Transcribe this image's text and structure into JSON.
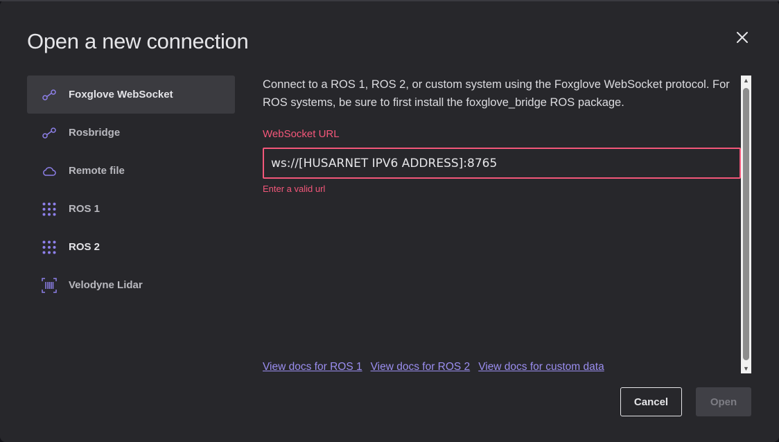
{
  "dialog": {
    "title": "Open a new connection",
    "close_icon": "close-icon"
  },
  "sidebar": {
    "items": [
      {
        "label": "Foxglove WebSocket",
        "icon": "websocket-connection-icon",
        "active": true
      },
      {
        "label": "Rosbridge",
        "icon": "websocket-connection-icon",
        "active": false
      },
      {
        "label": "Remote file",
        "icon": "cloud-icon",
        "active": false
      },
      {
        "label": "ROS 1",
        "icon": "dot-grid-icon",
        "active": false
      },
      {
        "label": "ROS 2",
        "icon": "dot-grid-icon",
        "active": false
      },
      {
        "label": "Velodyne Lidar",
        "icon": "barcode-scan-icon",
        "active": false
      }
    ]
  },
  "main": {
    "description": "Connect to a ROS 1, ROS 2, or custom system using the Foxglove WebSocket protocol. For ROS systems, be sure to first install the foxglove_bridge ROS package.",
    "url_field": {
      "label": "WebSocket URL",
      "value": "ws://[HUSARNET IPV6 ADDRESS]:8765",
      "error": "Enter a valid url"
    },
    "links": [
      "View docs for ROS 1",
      "View docs for ROS 2",
      "View docs for custom data"
    ]
  },
  "footer": {
    "cancel_label": "Cancel",
    "open_label": "Open"
  },
  "colors": {
    "accent": "#9b8ef0",
    "error": "#f4577a",
    "background": "#27272b"
  }
}
